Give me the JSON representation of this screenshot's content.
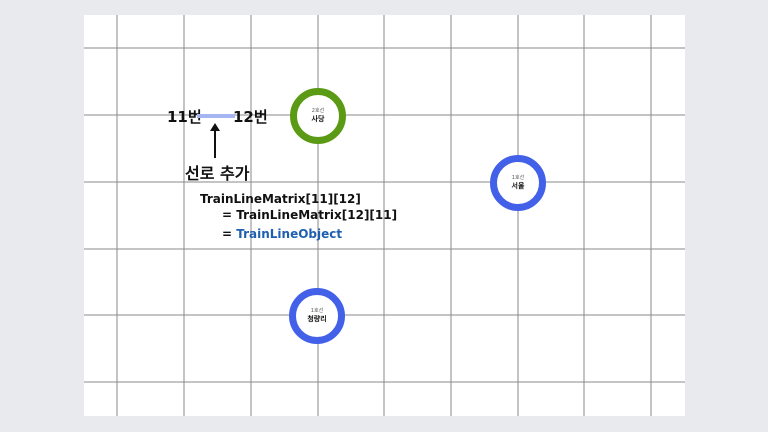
{
  "stations": [
    {
      "id": "sadang",
      "line": "2호선",
      "name": "사당",
      "color": "#5a9a14"
    },
    {
      "id": "seoul",
      "line": "1호선",
      "name": "서울",
      "color": "#4361e8"
    },
    {
      "id": "cheongnyangni",
      "line": "1호선",
      "name": "청량리",
      "color": "#4361e8"
    }
  ],
  "link": {
    "node_a": "11번",
    "node_b": "12번",
    "add_label": "선로 추가",
    "bar_color": "#a6b4f2"
  },
  "code": {
    "line1": "TrainLineMatrix[11][12]",
    "line2": "= TrainLineMatrix[12][11]",
    "line3_prefix": "= ",
    "line3_object": "TrainLineObject",
    "accent_color": "#1f5fb0"
  }
}
